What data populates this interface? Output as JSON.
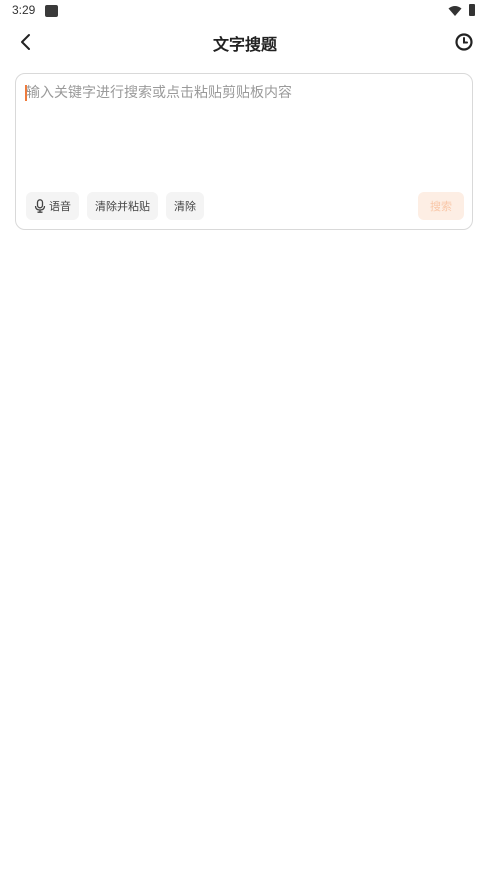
{
  "status_bar": {
    "time": "3:29"
  },
  "header": {
    "title": "文字搜题"
  },
  "input": {
    "placeholder": "输入关键字进行搜索或点击粘贴剪贴板内容",
    "value": ""
  },
  "actions": {
    "voice_label": "语音",
    "clear_paste_label": "清除并粘贴",
    "clear_label": "清除",
    "search_label": "搜索"
  },
  "icons": {
    "back": "chevron-left-icon",
    "history": "clock-icon",
    "mic": "microphone-icon"
  },
  "colors": {
    "accent": "#f07a3a",
    "search_button_bg": "#fdeee4",
    "search_button_text": "#f9c7a8",
    "card_border": "#d9d9d9",
    "chip_bg": "#f4f4f4"
  }
}
